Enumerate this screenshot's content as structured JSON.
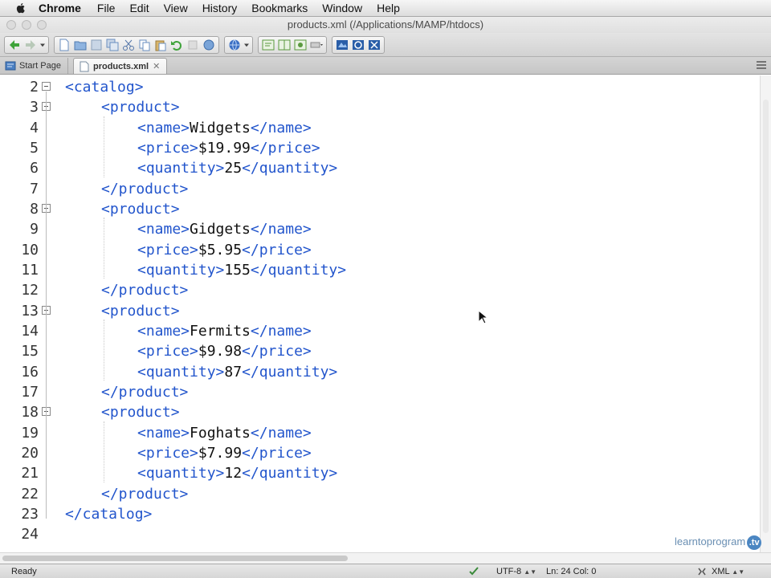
{
  "menubar": {
    "app": "Chrome",
    "items": [
      "File",
      "Edit",
      "View",
      "History",
      "Bookmarks",
      "Window",
      "Help"
    ]
  },
  "window": {
    "title": "products.xml (/Applications/MAMP/htdocs)"
  },
  "tabs": [
    {
      "label": "Start Page",
      "active": false
    },
    {
      "label": "products.xml",
      "active": true,
      "close": "✕"
    }
  ],
  "editor": {
    "lines": [
      {
        "n": "2",
        "indent": 0,
        "fold": true,
        "open": "<catalog>",
        "text": "",
        "close": ""
      },
      {
        "n": "3",
        "indent": 1,
        "fold": true,
        "open": "<product>",
        "text": "",
        "close": ""
      },
      {
        "n": "4",
        "indent": 2,
        "fold": false,
        "open": "<name>",
        "text": "Widgets",
        "close": "</name>"
      },
      {
        "n": "5",
        "indent": 2,
        "fold": false,
        "open": "<price>",
        "text": "$19.99",
        "close": "</price>"
      },
      {
        "n": "6",
        "indent": 2,
        "fold": false,
        "open": "<quantity>",
        "text": "25",
        "close": "</quantity>"
      },
      {
        "n": "7",
        "indent": 1,
        "fold": false,
        "open": "</product>",
        "text": "",
        "close": ""
      },
      {
        "n": "8",
        "indent": 1,
        "fold": true,
        "open": "<product>",
        "text": "",
        "close": ""
      },
      {
        "n": "9",
        "indent": 2,
        "fold": false,
        "open": "<name>",
        "text": "Gidgets",
        "close": "</name>"
      },
      {
        "n": "10",
        "indent": 2,
        "fold": false,
        "open": "<price>",
        "text": "$5.95",
        "close": "</price>"
      },
      {
        "n": "11",
        "indent": 2,
        "fold": false,
        "open": "<quantity>",
        "text": "155",
        "close": "</quantity>"
      },
      {
        "n": "12",
        "indent": 1,
        "fold": false,
        "open": "</product>",
        "text": "",
        "close": ""
      },
      {
        "n": "13",
        "indent": 1,
        "fold": true,
        "open": "<product>",
        "text": "",
        "close": ""
      },
      {
        "n": "14",
        "indent": 2,
        "fold": false,
        "open": "<name>",
        "text": "Fermits",
        "close": "</name>"
      },
      {
        "n": "15",
        "indent": 2,
        "fold": false,
        "open": "<price>",
        "text": "$9.98",
        "close": "</price>"
      },
      {
        "n": "16",
        "indent": 2,
        "fold": false,
        "open": "<quantity>",
        "text": "87",
        "close": "</quantity>"
      },
      {
        "n": "17",
        "indent": 1,
        "fold": false,
        "open": "</product>",
        "text": "",
        "close": ""
      },
      {
        "n": "18",
        "indent": 1,
        "fold": true,
        "open": "<product>",
        "text": "",
        "close": ""
      },
      {
        "n": "19",
        "indent": 2,
        "fold": false,
        "open": "<name>",
        "text": "Foghats",
        "close": "</name>"
      },
      {
        "n": "20",
        "indent": 2,
        "fold": false,
        "open": "<price>",
        "text": "$7.99",
        "close": "</price>"
      },
      {
        "n": "21",
        "indent": 2,
        "fold": false,
        "open": "<quantity>",
        "text": "12",
        "close": "</quantity>"
      },
      {
        "n": "22",
        "indent": 1,
        "fold": false,
        "open": "</product>",
        "text": "",
        "close": ""
      },
      {
        "n": "23",
        "indent": 0,
        "fold": false,
        "open": "</catalog>",
        "text": "",
        "close": ""
      },
      {
        "n": "24",
        "indent": 0,
        "fold": false,
        "open": "",
        "text": "",
        "close": ""
      }
    ]
  },
  "statusbar": {
    "status": "Ready",
    "encoding": "UTF-8",
    "position": "Ln: 24 Col: 0",
    "language": "XML",
    "arrows": "▲▼"
  },
  "watermark": {
    "text": "learntoprogram",
    "badge": ".tv"
  },
  "colors": {
    "tag": "#2255cc",
    "text": "#111111"
  }
}
